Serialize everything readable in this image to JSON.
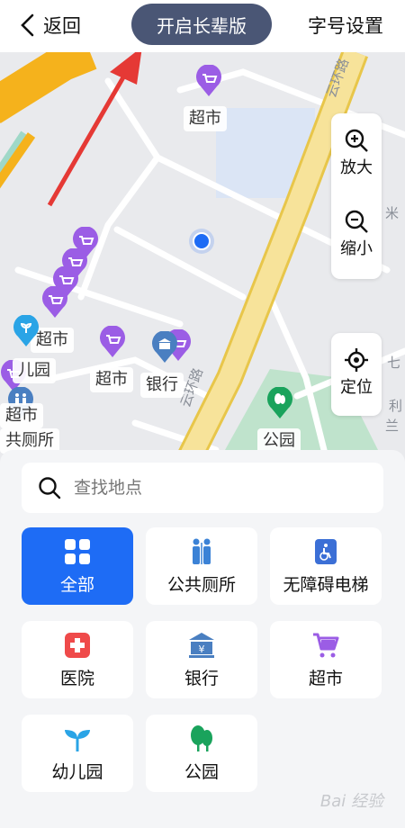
{
  "topbar": {
    "back_label": "返回",
    "elder_mode_label": "开启长辈版",
    "font_size_label": "字号设置"
  },
  "map": {
    "labels": {
      "supermarket_top": "超市",
      "supermarket_left_a": "超市",
      "supermarket_left_b": "超市",
      "supermarket_center": "超市",
      "bank": "银行",
      "park": "公园",
      "kindergarten_partial": "儿园",
      "toilet_partial": "共厕所"
    },
    "street_texts": {
      "road_top": "云环路",
      "road_bottom": "云环路",
      "rice_partial": "米",
      "li_partial": "利",
      "lan_partial": "兰",
      "qi_partial": "七"
    },
    "controls": {
      "zoom_in": "放大",
      "zoom_out": "缩小",
      "locate": "定位"
    }
  },
  "panel": {
    "search_placeholder": "查找地点",
    "categories": [
      {
        "label": "全部",
        "icon": "grid-icon",
        "active": true
      },
      {
        "label": "公共厕所",
        "icon": "toilet-icon"
      },
      {
        "label": "无障碍电梯",
        "icon": "accessible-elevator-icon"
      },
      {
        "label": "医院",
        "icon": "hospital-icon"
      },
      {
        "label": "银行",
        "icon": "bank-icon"
      },
      {
        "label": "超市",
        "icon": "cart-icon"
      },
      {
        "label": "幼儿园",
        "icon": "sprout-icon"
      },
      {
        "label": "公园",
        "icon": "tree-icon"
      }
    ],
    "watermark": "Bai 经验"
  },
  "colors": {
    "primary": "#1e6cf5",
    "elder_button": "#4a5675",
    "supermarket_pin": "#9b5de5",
    "bank_pin": "#4a7fc1",
    "park_pin": "#1aa35c",
    "main_road": "#f7dc6f"
  }
}
